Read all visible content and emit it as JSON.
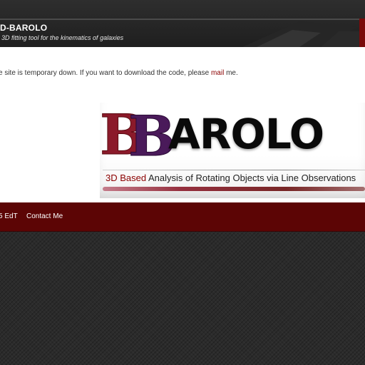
{
  "header": {
    "title": "D-BAROLO",
    "tagline": "3D fitting tool for the kinematics of galaxies"
  },
  "notice": {
    "text_before": "e site is temporary down. If you want to download the code, please ",
    "link_text": "mail",
    "text_after": " me."
  },
  "logo": {
    "letter_1": "B",
    "letter_2": "B",
    "rest_text": "AROLO",
    "subtitle_highlight": "3D Based",
    "subtitle_rest": " Analysis of Rotating Objects via Line Observations"
  },
  "footer": {
    "left_text": "5 EdT",
    "contact_label": "Contact Me"
  },
  "colors": {
    "accent_red": "#8b0000",
    "footer_bg": "#5c0505",
    "logo_purple": "#4a1a5a"
  }
}
